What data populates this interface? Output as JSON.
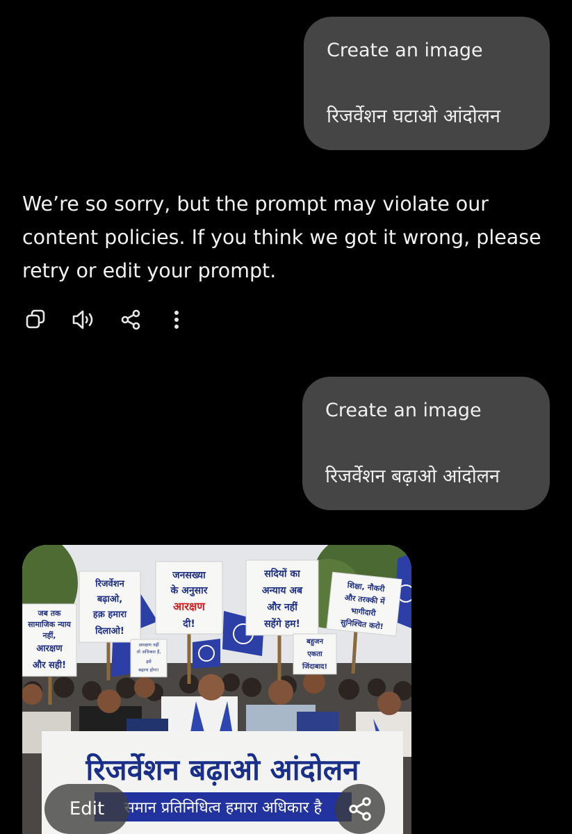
{
  "conversation": {
    "prompt1": {
      "line1": "Create an image",
      "line2": "रिजर्वेशन घटाओ आंदोलन"
    },
    "reply": "We’re so sorry, but the prompt may violate our content policies. If you think we got it wrong, please retry or edit your prompt.",
    "reply_actions": [
      "copy-icon",
      "speaker-icon",
      "share-icon",
      "more-vertical-icon"
    ],
    "prompt2": {
      "line1": "Create an image",
      "line2": "रिजर्वेशन बढ़ाओ आंदोलन"
    }
  },
  "generated_image": {
    "signs": {
      "s1": [
        "जब तक",
        "सामाजिक न्याय",
        "नहीं,",
        "आरक्षण",
        "और सही!"
      ],
      "s2": [
        "रिजर्वेशन",
        "बढ़ाओ,",
        "हक़ हमारा",
        "दिलाओ!"
      ],
      "s3_black": [
        "जनसख्या",
        "के अनुसार"
      ],
      "s3_red": [
        "आरक्षण"
      ],
      "s3_end": [
        "दी!"
      ],
      "s4": [
        "सदियों का",
        "अन्याय अब",
        "और नहीं",
        "सहेंगे हम!"
      ],
      "s5": [
        "शिक्षा, नौकरी",
        "और तरक्की में",
        "भागीदारी",
        "सुनिश्चित करो!"
      ],
      "s6": [
        "बहुजन",
        "एकता",
        "जिंदाबाद!"
      ],
      "s7": [
        "आरक्षण नहीं",
        "तो अधिकार है,",
        "इसे",
        "बढ़ाना होगा!"
      ]
    },
    "banner_title": "रिजर्वेशन बढ़ाओ आंदोलन",
    "banner_subtitle": "समान प्रतिनिधित्व हमारा अधिकार है"
  },
  "image_controls": {
    "edit_label": "Edit",
    "share_icon": "share-icon"
  },
  "colors": {
    "background": "#000000",
    "bubble": "#454545",
    "protest_blue": "#2b3fa6",
    "banner_text": "#1a2f8a",
    "accent_red": "#d22020"
  }
}
